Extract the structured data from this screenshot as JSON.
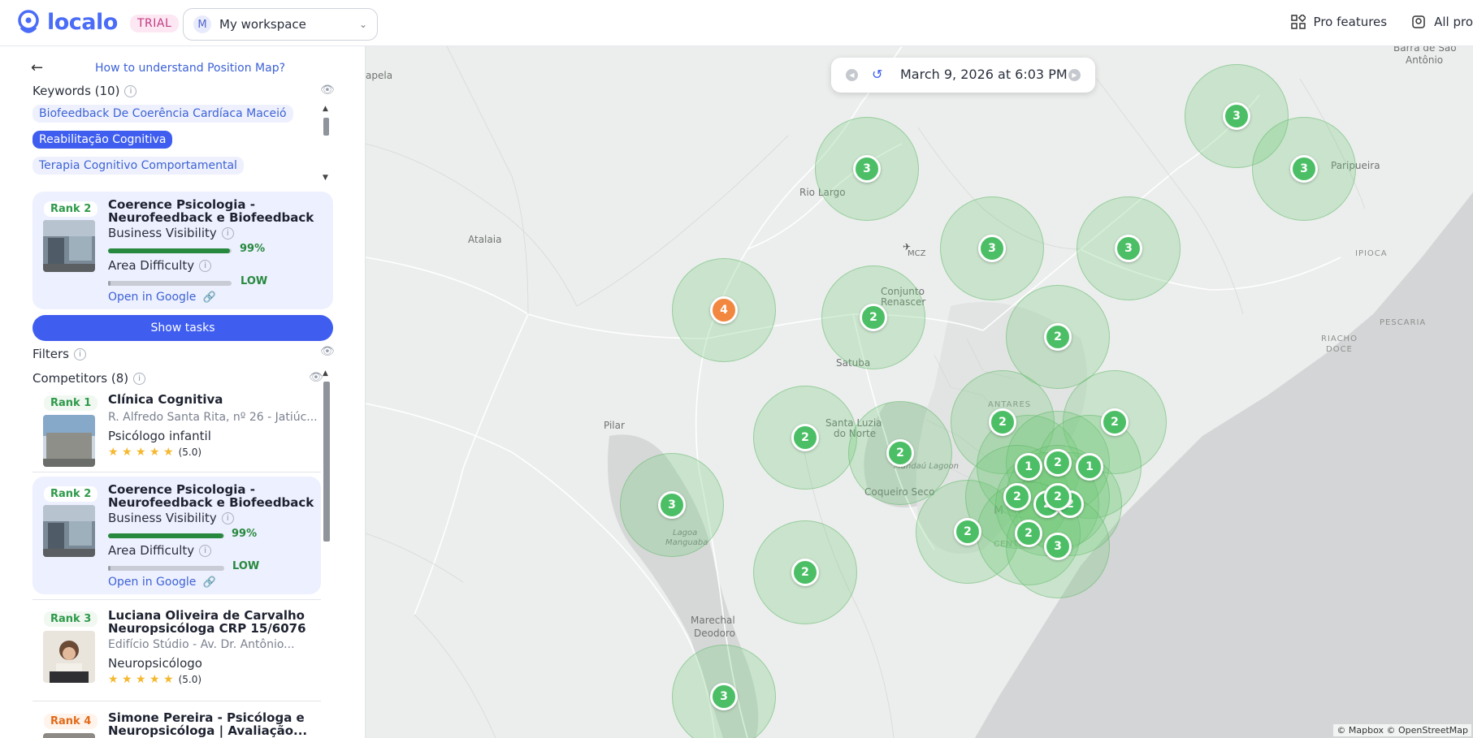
{
  "header": {
    "logo_text": "localo",
    "trial_badge": "TRIAL",
    "workspace_initial": "M",
    "workspace_name": "My workspace",
    "pro_features": "Pro features",
    "all_projects": "All pro"
  },
  "panel": {
    "howto_link": "How to understand Position Map?",
    "keywords_title": "Keywords (10)",
    "keywords": [
      "Biofeedback De Coerência Cardíaca Maceió",
      "Reabilitação Cognitiva",
      "Terapia Cognitivo Comportamental"
    ],
    "selected": {
      "rank": "Rank 2",
      "name_line1": "Coerence Psicologia -",
      "name_line2": "Neurofeedback e Biofeedback",
      "visibility_label": "Business Visibility",
      "visibility_value": "99%",
      "visibility_fraction": 0.99,
      "difficulty_label": "Area Difficulty",
      "difficulty_value": "LOW",
      "open_google": "Open in Google"
    },
    "show_tasks": "Show tasks",
    "filters_title": "Filters",
    "competitors_title": "Competitors (8)",
    "competitors": [
      {
        "rank": "Rank 1",
        "name1": "Clínica Cognitiva",
        "name2": "",
        "address": "R. Alfredo Santa Rita, nº 26 - Jatiúc...",
        "category": "Psicólogo infantil",
        "rating": "(5.0)"
      },
      {
        "rank": "Rank 2",
        "name1": "Coerence Psicologia -",
        "name2": "Neurofeedback e Biofeedback",
        "visibility_label": "Business Visibility",
        "visibility_value": "99%",
        "difficulty_label": "Area Difficulty",
        "difficulty_value": "LOW",
        "open_google": "Open in Google"
      },
      {
        "rank": "Rank 3",
        "name1": "Luciana Oliveira de Carvalho",
        "name2": "Neuropsicóloga CRP 15/6076",
        "address": "Edifício Stúdio - Av. Dr. Antônio...",
        "category": "Neuropsicólogo",
        "rating": "(5.0)"
      },
      {
        "rank": "Rank 4",
        "name1": "Simone Pereira - Psicóloga e",
        "name2": "Neuropsicóloga | Avaliação..."
      }
    ]
  },
  "map": {
    "date": "March 9, 2026 at 6:03 PM",
    "attribution": "© Mapbox © OpenStreetMap",
    "places": [
      "Barra de São",
      "Antônio",
      "Rio Largo",
      "Atalaia",
      "Paripueira",
      "IPIOCA",
      "MCZ",
      "Conjunto",
      "Renascer",
      "Satuba",
      "RIACHO",
      "DOCE",
      "PESCARIA",
      "ANTARES",
      "Santa Luzia",
      "do Norte",
      "Pilar",
      "Mundaú Lagoon",
      "Coqueiro Seco",
      "Lagoa",
      "Manguaba",
      "Marechal",
      "Deodoro",
      "M",
      "CENTR",
      "apela"
    ],
    "markers": [
      "3",
      "3",
      "3",
      "3",
      "3",
      "4",
      "2",
      "2",
      "2",
      "2",
      "2",
      "2",
      "3",
      "2",
      "2",
      "1",
      "2",
      "1",
      "2",
      "2",
      "2",
      "2",
      "2",
      "3",
      "3"
    ]
  },
  "colors": {
    "accent": "#3f5ef0",
    "marker_green": "#4cbf66",
    "marker_orange": "#f2883f",
    "rank_green": "#2e9a4a"
  }
}
